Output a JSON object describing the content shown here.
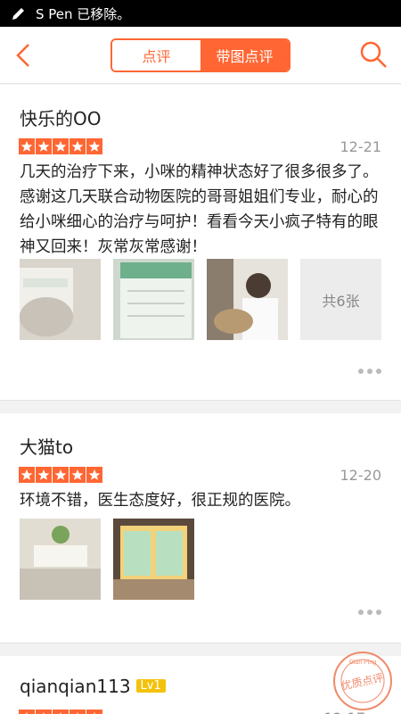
{
  "status": {
    "text": "S Pen 已移除。"
  },
  "nav": {
    "tab_reviews": "点评",
    "tab_with_photos": "带图点评"
  },
  "reviews": [
    {
      "user": "快乐的OO",
      "date": "12-21",
      "text": "几天的治疗下来，小咪的精神状态好了很多很多了。感谢这几天联合动物医院的哥哥姐姐们专业，耐心的给小咪细心的治疗与呵护！看看今天小疯子特有的眼神又回来！灰常灰常感谢！",
      "photo_count": "共6张"
    },
    {
      "user": "大猫to",
      "date": "12-20",
      "text": "环境不错，医生态度好，很正规的医院。"
    },
    {
      "user": "qianqian113",
      "level": "Lv1",
      "date": "12-17"
    }
  ],
  "seal": {
    "label": "优质点评",
    "arc": "Dian Ping"
  },
  "colors": {
    "accent": "#ff6633",
    "level_badge": "#f4c20d"
  }
}
